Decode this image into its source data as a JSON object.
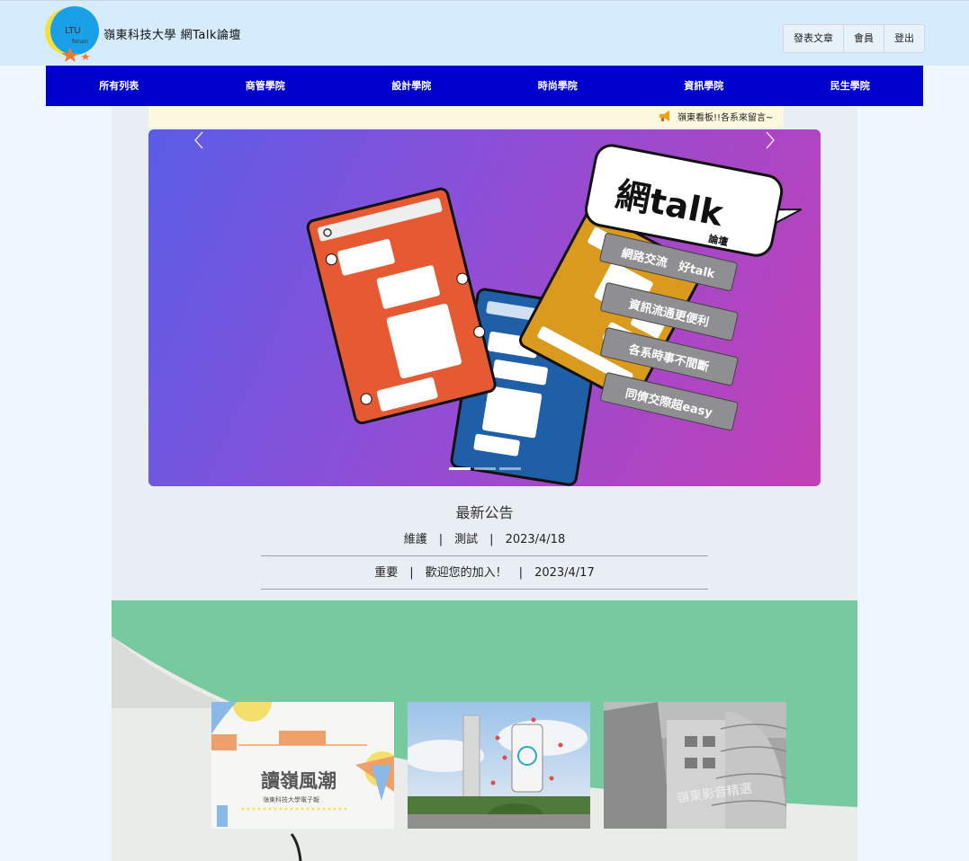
{
  "header": {
    "logo_text": "LTU",
    "logo_sub": "forum",
    "title": "嶺東科技大學 網Talk論壇",
    "nav": [
      "發表文章",
      "會員",
      "登出"
    ]
  },
  "main_nav": [
    "所有列表",
    "商管學院",
    "設計學院",
    "時尚學院",
    "資訊學院",
    "民生學院"
  ],
  "marquee": "嶺東看板!!各系來留言~",
  "carousel": {
    "brand_top": "網talk",
    "brand_sub": "論壇",
    "slogans": [
      "網路交流　好talk",
      "資訊流通更便利",
      "各系時事不間斷",
      "同儕交際超easy"
    ],
    "slides": 3,
    "active_slide": 1
  },
  "announcements": {
    "title": "最新公告",
    "items": [
      {
        "tag": "維護",
        "text": "測試",
        "date": "2023/4/18"
      },
      {
        "tag": "重要",
        "text": "歡迎您的加入！",
        "date": "2023/4/17"
      }
    ]
  },
  "cards": [
    {
      "title": "讀嶺風潮",
      "subtitle": "嶺東科技大學電子報"
    },
    {
      "title": ""
    },
    {
      "title": "嶺東影音精選"
    }
  ],
  "colors": {
    "topbar": "#d6ebfb",
    "nav": "#0000cc",
    "green_section": "#77c9a0"
  }
}
